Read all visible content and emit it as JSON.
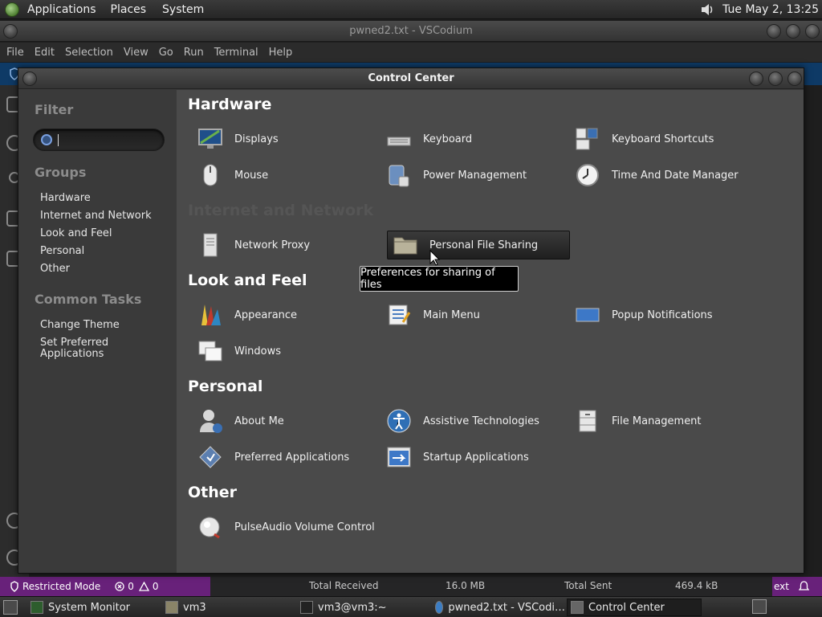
{
  "top_panel": {
    "menus": [
      "Applications",
      "Places",
      "System"
    ],
    "clock": "Tue May  2, 13:25",
    "icons": [
      "mate-logo-icon",
      "volume-icon"
    ]
  },
  "vscodium": {
    "title": "pwned2.txt - VSCodium",
    "menu": [
      "File",
      "Edit",
      "Selection",
      "View",
      "Go",
      "Run",
      "Terminal",
      "Help"
    ],
    "status_restricted": "Restricted Mode",
    "status_errors": "0",
    "status_warnings": "0",
    "status_total_received_label": "Total Received",
    "status_total_received_value": "16.0 MB",
    "status_total_sent_label": "Total Sent",
    "status_total_sent_value": "469.4 kB",
    "status_right": "ext"
  },
  "control_center": {
    "title": "Control Center",
    "sidebar": {
      "filter_label": "Filter",
      "search_value": "",
      "groups_label": "Groups",
      "groups": [
        "Hardware",
        "Internet and Network",
        "Look and Feel",
        "Personal",
        "Other"
      ],
      "common_tasks_label": "Common Tasks",
      "tasks": [
        "Change Theme",
        "Set Preferred\nApplications"
      ]
    },
    "sections": [
      {
        "title": "Hardware",
        "items": [
          {
            "label": "Displays",
            "icon": "display-icon"
          },
          {
            "label": "Keyboard",
            "icon": "keyboard-icon"
          },
          {
            "label": "Keyboard Shortcuts",
            "icon": "keyboard-shortcuts-icon"
          },
          {
            "label": "Mouse",
            "icon": "mouse-icon"
          },
          {
            "label": "Power Management",
            "icon": "power-management-icon"
          },
          {
            "label": "Time And Date Manager",
            "icon": "clock-icon"
          }
        ]
      },
      {
        "title": "Internet and Network",
        "items": [
          {
            "label": "Network Proxy",
            "icon": "network-proxy-icon"
          },
          {
            "label": "Personal File Sharing",
            "icon": "folder-share-icon"
          }
        ]
      },
      {
        "title": "Look and Feel",
        "items": [
          {
            "label": "Appearance",
            "icon": "appearance-icon"
          },
          {
            "label": "Main Menu",
            "icon": "main-menu-icon"
          },
          {
            "label": "Popup Notifications",
            "icon": "popup-notifications-icon"
          },
          {
            "label": "Windows",
            "icon": "windows-icon"
          }
        ]
      },
      {
        "title": "Personal",
        "items": [
          {
            "label": "About Me",
            "icon": "about-me-icon"
          },
          {
            "label": "Assistive Technologies",
            "icon": "accessibility-icon"
          },
          {
            "label": "File Management",
            "icon": "file-management-icon"
          },
          {
            "label": "Preferred Applications",
            "icon": "preferred-apps-icon"
          },
          {
            "label": "Startup Applications",
            "icon": "startup-apps-icon"
          }
        ]
      },
      {
        "title": "Other",
        "items": [
          {
            "label": "PulseAudio Volume Control",
            "icon": "pulseaudio-icon"
          }
        ]
      }
    ],
    "tooltip": "Preferences for sharing of files"
  },
  "taskbar": {
    "tasks": [
      {
        "label": "System Monitor",
        "icon": "system-monitor-icon"
      },
      {
        "label": "vm3",
        "icon": "home-folder-icon"
      },
      {
        "label": "vm3@vm3:~",
        "icon": "terminal-icon"
      },
      {
        "label": "pwned2.txt - VSCodi…",
        "icon": "vscodium-icon"
      },
      {
        "label": "Control Center",
        "icon": "control-center-icon"
      }
    ]
  }
}
